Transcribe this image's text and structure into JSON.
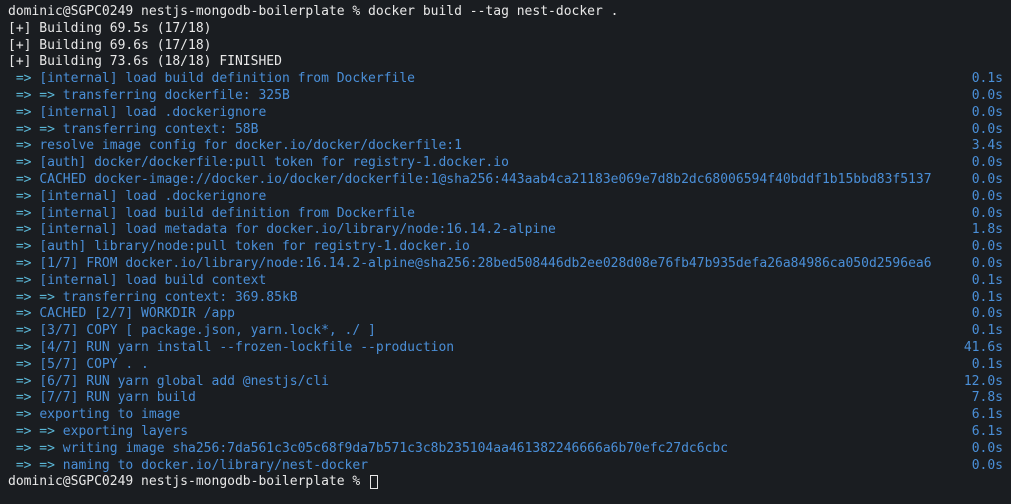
{
  "prompt1": {
    "user": "dominic",
    "at": "@",
    "host": "SGPC0249",
    "dir": "nestjs-mongodb-boilerplate",
    "sep": " % ",
    "cmd": "docker build --tag nest-docker ."
  },
  "build_status": [
    "[+] Building 69.5s (17/18)",
    "[+] Building 69.6s (17/18)",
    "[+] Building 73.6s (18/18) FINISHED"
  ],
  "steps": [
    {
      "arrow": "=> ",
      "text": "[internal] load build definition from Dockerfile",
      "time": "0.1s"
    },
    {
      "arrow": "=> => ",
      "text": "transferring dockerfile: 325B",
      "time": "0.0s"
    },
    {
      "arrow": "=> ",
      "text": "[internal] load .dockerignore",
      "time": "0.0s"
    },
    {
      "arrow": "=> => ",
      "text": "transferring context: 58B",
      "time": "0.0s"
    },
    {
      "arrow": "=> ",
      "text": "resolve image config for docker.io/docker/dockerfile:1",
      "time": "3.4s"
    },
    {
      "arrow": "=> ",
      "text": "[auth] docker/dockerfile:pull token for registry-1.docker.io",
      "time": "0.0s"
    },
    {
      "arrow": "=> ",
      "text": "CACHED docker-image://docker.io/docker/dockerfile:1@sha256:443aab4ca21183e069e7d8b2dc68006594f40bddf1b15bbd83f5137",
      "time": "0.0s"
    },
    {
      "arrow": "=> ",
      "text": "[internal] load .dockerignore",
      "time": "0.0s"
    },
    {
      "arrow": "=> ",
      "text": "[internal] load build definition from Dockerfile",
      "time": "0.0s"
    },
    {
      "arrow": "=> ",
      "text": "[internal] load metadata for docker.io/library/node:16.14.2-alpine",
      "time": "1.8s"
    },
    {
      "arrow": "=> ",
      "text": "[auth] library/node:pull token for registry-1.docker.io",
      "time": "0.0s"
    },
    {
      "arrow": "=> ",
      "text": "[1/7] FROM docker.io/library/node:16.14.2-alpine@sha256:28bed508446db2ee028d08e76fb47b935defa26a84986ca050d2596ea6",
      "time": "0.0s"
    },
    {
      "arrow": "=> ",
      "text": "[internal] load build context",
      "time": "0.1s"
    },
    {
      "arrow": "=> => ",
      "text": "transferring context: 369.85kB",
      "time": "0.1s"
    },
    {
      "arrow": "=> ",
      "text": "CACHED [2/7] WORKDIR /app",
      "time": "0.0s"
    },
    {
      "arrow": "=> ",
      "text": "[3/7] COPY [ package.json, yarn.lock*, ./ ]",
      "time": "0.1s"
    },
    {
      "arrow": "=> ",
      "text": "[4/7] RUN yarn install --frozen-lockfile --production",
      "time": "41.6s"
    },
    {
      "arrow": "=> ",
      "text": "[5/7] COPY . .",
      "time": "0.1s"
    },
    {
      "arrow": "=> ",
      "text": "[6/7] RUN yarn global add @nestjs/cli",
      "time": "12.0s"
    },
    {
      "arrow": "=> ",
      "text": "[7/7] RUN yarn build",
      "time": "7.8s"
    },
    {
      "arrow": "=> ",
      "text": "exporting to image",
      "time": "6.1s"
    },
    {
      "arrow": "=> => ",
      "text": "exporting layers",
      "time": "6.1s"
    },
    {
      "arrow": "=> => ",
      "text": "writing image sha256:7da561c3c05c68f9da7b571c3c8b235104aa461382246666a6b70efc27dc6cbc",
      "time": "0.0s"
    },
    {
      "arrow": "=> => ",
      "text": "naming to docker.io/library/nest-docker",
      "time": "0.0s"
    }
  ],
  "prompt2": {
    "user": "dominic",
    "at": "@",
    "host": "SGPC0249",
    "dir": "nestjs-mongodb-boilerplate",
    "sep": " % "
  }
}
